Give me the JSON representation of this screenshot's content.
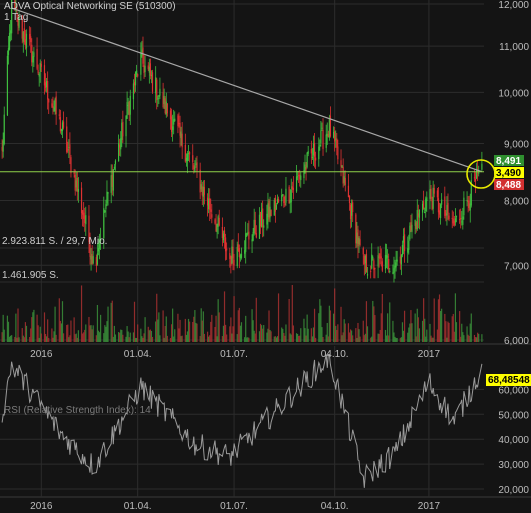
{
  "header": {
    "title": "ADVA Optical Networking SE (510300)",
    "interval": "1 Tag",
    "volume_label_top": "2.923.811 S. / 29,7 Mio.",
    "volume_label_mid": "1.461.905 S.",
    "rsi_label": "RSI (Relative Strength Index): 14"
  },
  "colors": {
    "background": "#141414",
    "grid": "#2c2c2c",
    "candle_up": "#3fbf3f",
    "candle_down": "#e03232",
    "trendline": "#a8a8a8",
    "horizontal_line": "#8fd04a",
    "badge_green": "#2f8f2f",
    "badge_yellow": "#ffff00",
    "badge_red": "#d23030",
    "rsi_line": "#9a9a9a",
    "circle": "#e8e800"
  },
  "price_axis": {
    "ticks": [
      {
        "value": 12000,
        "label": "12,000"
      },
      {
        "value": 11000,
        "label": "11,000"
      },
      {
        "value": 10000,
        "label": "10,000"
      },
      {
        "value": 9000,
        "label": "9,000"
      },
      {
        "value": 8000,
        "label": "8,000"
      },
      {
        "value": 7000,
        "label": "7,000"
      },
      {
        "value": 6000,
        "label": "6,000"
      }
    ],
    "scale": "log"
  },
  "rsi_axis": {
    "ticks": [
      {
        "value": 60,
        "label": "60,000"
      },
      {
        "value": 50,
        "label": "50,000"
      },
      {
        "value": 40,
        "label": "40,000"
      },
      {
        "value": 30,
        "label": "30,000"
      },
      {
        "value": 20,
        "label": "20,000"
      }
    ],
    "last_label": "68,48548"
  },
  "time_axis": {
    "labels": [
      "2016",
      "01.04.",
      "01.07.",
      "04.10.",
      "2017"
    ]
  },
  "badges": {
    "high": "8,491",
    "mid": "3,490",
    "low": "8,488"
  },
  "chart_data": [
    {
      "type": "candlestick",
      "title": "ADVA Optical Networking SE (510300)",
      "x_range": [
        "2015-11",
        "2017-01"
      ],
      "ylim": [
        6000,
        12000
      ],
      "key_points": [
        {
          "x": "2015-11-25",
          "close": 8800
        },
        {
          "x": "2015-12-04",
          "close": 11900
        },
        {
          "x": "2016-01-20",
          "close": 9300
        },
        {
          "x": "2016-02-20",
          "close": 7000
        },
        {
          "x": "2016-04-04",
          "close": 10700
        },
        {
          "x": "2016-05-25",
          "close": 8500
        },
        {
          "x": "2016-06-27",
          "close": 7100
        },
        {
          "x": "2016-08-25",
          "close": 8200
        },
        {
          "x": "2016-09-29",
          "close": 9300
        },
        {
          "x": "2016-10-31",
          "close": 7000
        },
        {
          "x": "2016-12-01",
          "close": 7050
        },
        {
          "x": "2017-01-01",
          "close": 8100
        },
        {
          "x": "2017-01-25",
          "close": 7600
        },
        {
          "x": "2017-02-20",
          "close": 8490
        }
      ],
      "trendline": [
        {
          "x": "2015-12-04",
          "y": 11900
        },
        {
          "x": "2017-02-20",
          "y": 8490
        }
      ],
      "horizontal_level": 8490,
      "last_values": {
        "high": "8,491",
        "mid": "3,490",
        "low": "8,488"
      }
    },
    {
      "type": "bar",
      "title": "Volume",
      "labels": [
        "2.923.811 S. / 29,7 Mio.",
        "1.461.905 S."
      ]
    },
    {
      "type": "line",
      "title": "RSI (Relative Strength Index): 14",
      "ylim": [
        18,
        75
      ],
      "key_points": [
        {
          "x": "2015-11-25",
          "y": 50
        },
        {
          "x": "2015-12-04",
          "y": 70
        },
        {
          "x": "2016-01-20",
          "y": 42
        },
        {
          "x": "2016-02-20",
          "y": 29
        },
        {
          "x": "2016-04-04",
          "y": 61
        },
        {
          "x": "2016-05-25",
          "y": 38
        },
        {
          "x": "2016-06-27",
          "y": 33
        },
        {
          "x": "2016-08-25",
          "y": 58
        },
        {
          "x": "2016-09-29",
          "y": 73
        },
        {
          "x": "2016-10-31",
          "y": 24
        },
        {
          "x": "2016-12-01",
          "y": 35
        },
        {
          "x": "2017-01-01",
          "y": 63
        },
        {
          "x": "2017-01-25",
          "y": 47
        },
        {
          "x": "2017-02-20",
          "y": 68.5
        }
      ],
      "last_value": "68,48548"
    }
  ]
}
